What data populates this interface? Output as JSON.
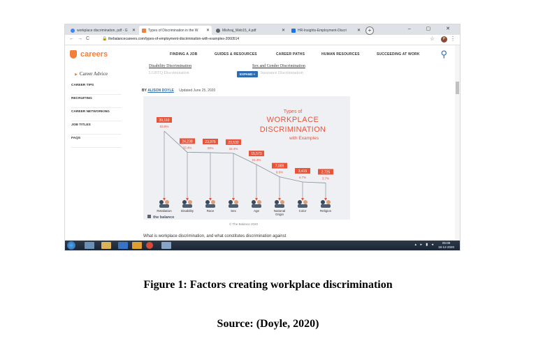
{
  "browser": {
    "tabs": [
      {
        "title": "workplace discrimination, pdf - G",
        "active": false,
        "color": "#4285f4"
      },
      {
        "title": "Types of Discrimination in the W",
        "active": true,
        "color": "#f0803c"
      },
      {
        "title": "Mishraj_Web15_4.pdf",
        "active": false,
        "color": "#5f6368"
      },
      {
        "title": "HR-Insights-Employment-Discri",
        "active": false,
        "color": "#1a73e8"
      }
    ],
    "new_tab": "+",
    "window_controls": "– ▢ ✕",
    "back": "←",
    "forward": "→",
    "reload": "C",
    "lock": "🔒",
    "url": "thebalancecareers.com/types-of-employment-discrimination-with-examples-2060514",
    "star": "☆",
    "profile_initial": "P",
    "menu": "⋮"
  },
  "site": {
    "logo": "careers",
    "nav": [
      "FINDING A JOB",
      "GUIDES & RESOURCES",
      "CAREER PATHS",
      "HUMAN RESOURCES",
      "SUCCEEDING AT WORK"
    ],
    "career_advice": "Career Advice",
    "sidebar": [
      "CAREER TIPS",
      "RECRUITING",
      "CAREER NETWORKING",
      "JOB TITLES",
      "FAQS"
    ],
    "related": {
      "disability": "Disability Discrimination",
      "sex_gender": "Sex and Gender Discrimination",
      "lgbtq": "LGBTQ Discrimination",
      "other": "Insurance Discrimination",
      "expand": "EXPAND +"
    },
    "byline": {
      "by": "BY",
      "author": "ALISON DOYLE",
      "date": "Updated June 25, 2020"
    },
    "credit": "© The Balance 2020",
    "paragraph": "What is workplace discrimination, and what constitutes discrimination against"
  },
  "infographic": {
    "title_line1": "Types of",
    "title_line2": "WORKPLACE",
    "title_line3": "DISCRIMINATION",
    "title_line4": "with Examples",
    "brand": "the balance",
    "accent": "#e8543a",
    "bars": [
      {
        "category": "Retaliation",
        "count": "39,110",
        "percent": "53.8%"
      },
      {
        "category": "Disability",
        "count": "24,238",
        "percent": "33.4%"
      },
      {
        "category": "Race",
        "count": "23,976",
        "percent": "33%"
      },
      {
        "category": "Sex",
        "count": "23,532",
        "percent": "32.4%"
      },
      {
        "category": "Age",
        "count": "15,573",
        "percent": "21.4%"
      },
      {
        "category": "National Origin",
        "count": "7,009",
        "percent": "9.6%"
      },
      {
        "category": "Color",
        "count": "3,415",
        "percent": "4.7%"
      },
      {
        "category": "Religion",
        "count": "2,725",
        "percent": "3.7%"
      }
    ]
  },
  "taskbar": {
    "tray": "▴ ▸ ▮ ◂",
    "time": "05:08",
    "date": "18-12-2020"
  },
  "captions": {
    "figure": "Figure 1: Factors creating workplace discrimination",
    "source": "Source: (Doyle, 2020)"
  }
}
